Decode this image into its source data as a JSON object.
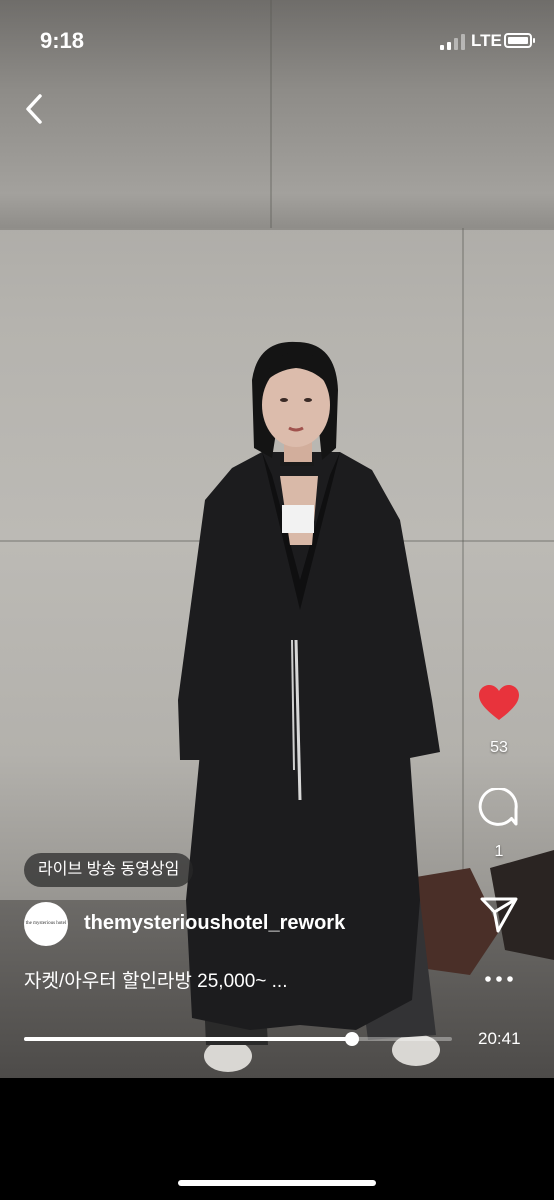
{
  "status_bar": {
    "time": "9:18",
    "carrier": "LTE"
  },
  "video": {
    "description": "Model wearing a long black leather coat standing against a concrete wall"
  },
  "actions": {
    "likes": {
      "icon": "heart-icon",
      "count": "53",
      "liked": true,
      "color": "#e8333c"
    },
    "comments": {
      "icon": "comment-icon",
      "count": "1"
    },
    "share": {
      "icon": "send-icon"
    },
    "more": {
      "icon": "more-icon"
    }
  },
  "post": {
    "badge": "라이브 방송 동영상임",
    "avatar_logo_text": "the mysterious hotel",
    "username": "themysterioushotel_rework",
    "caption": "자켓/아우터 할인라방 25,000~ ..."
  },
  "playback": {
    "progress": 0.767,
    "duration": "20:41"
  }
}
